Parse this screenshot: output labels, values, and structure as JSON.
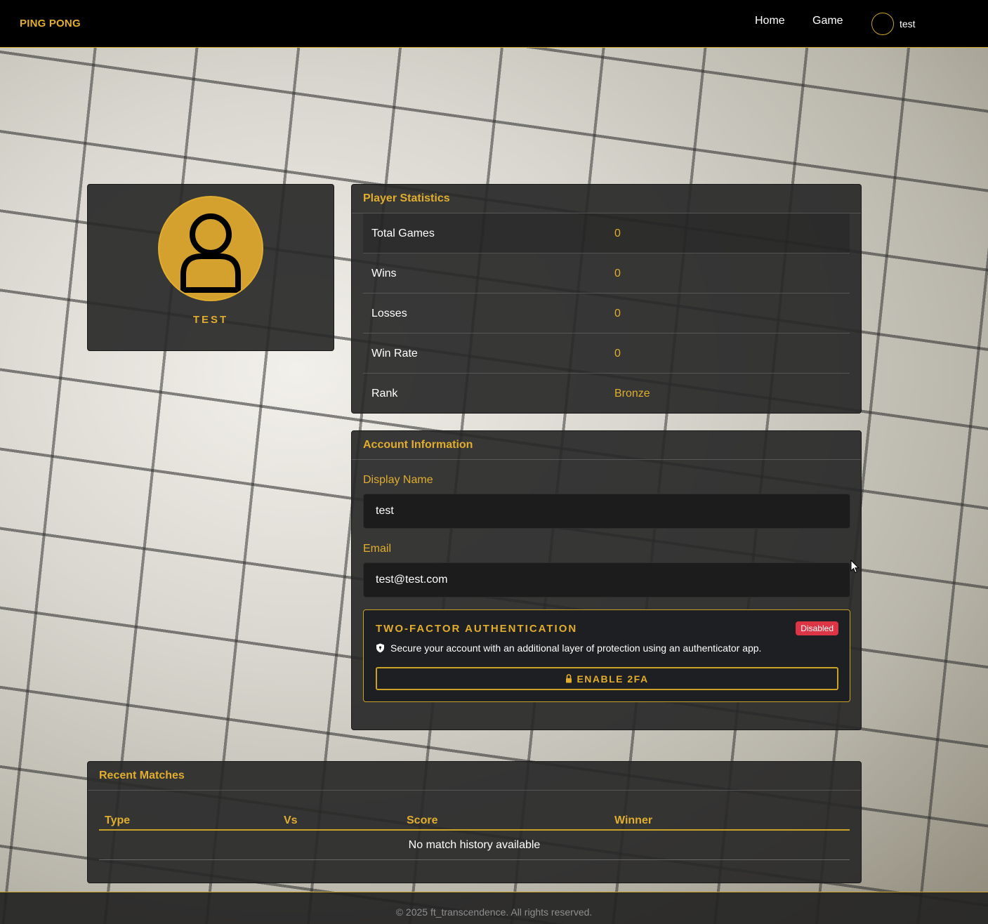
{
  "nav": {
    "brand": "PING PONG",
    "links": [
      "Home",
      "Game"
    ],
    "username": "test"
  },
  "profile": {
    "display_name": "TEST",
    "avatar_icon": "user-silhouette-icon"
  },
  "stats": {
    "title": "Player Statistics",
    "rows": [
      {
        "label": "Total Games",
        "value": "0"
      },
      {
        "label": "Wins",
        "value": "0"
      },
      {
        "label": "Losses",
        "value": "0"
      },
      {
        "label": "Win Rate",
        "value": "0"
      },
      {
        "label": "Rank",
        "value": "Bronze"
      }
    ]
  },
  "account": {
    "title": "Account Information",
    "display_name_label": "Display Name",
    "display_name_value": "test",
    "email_label": "Email",
    "email_value": "test@test.com",
    "tfa": {
      "title": "TWO-FACTOR AUTHENTICATION",
      "status": "Disabled",
      "description": "Secure your account with an additional layer of protection using an authenticator app.",
      "button_label": "ENABLE 2FA"
    }
  },
  "matches": {
    "title": "Recent Matches",
    "columns": [
      "Type",
      "Vs",
      "Score",
      "Winner"
    ],
    "empty_text": "No match history available"
  },
  "footer": {
    "text": "© 2025 ft_transcendence. All rights reserved."
  },
  "colors": {
    "accent": "#e0ad2e",
    "badge_disabled": "#dc3545",
    "navbar_bg": "#000000"
  }
}
